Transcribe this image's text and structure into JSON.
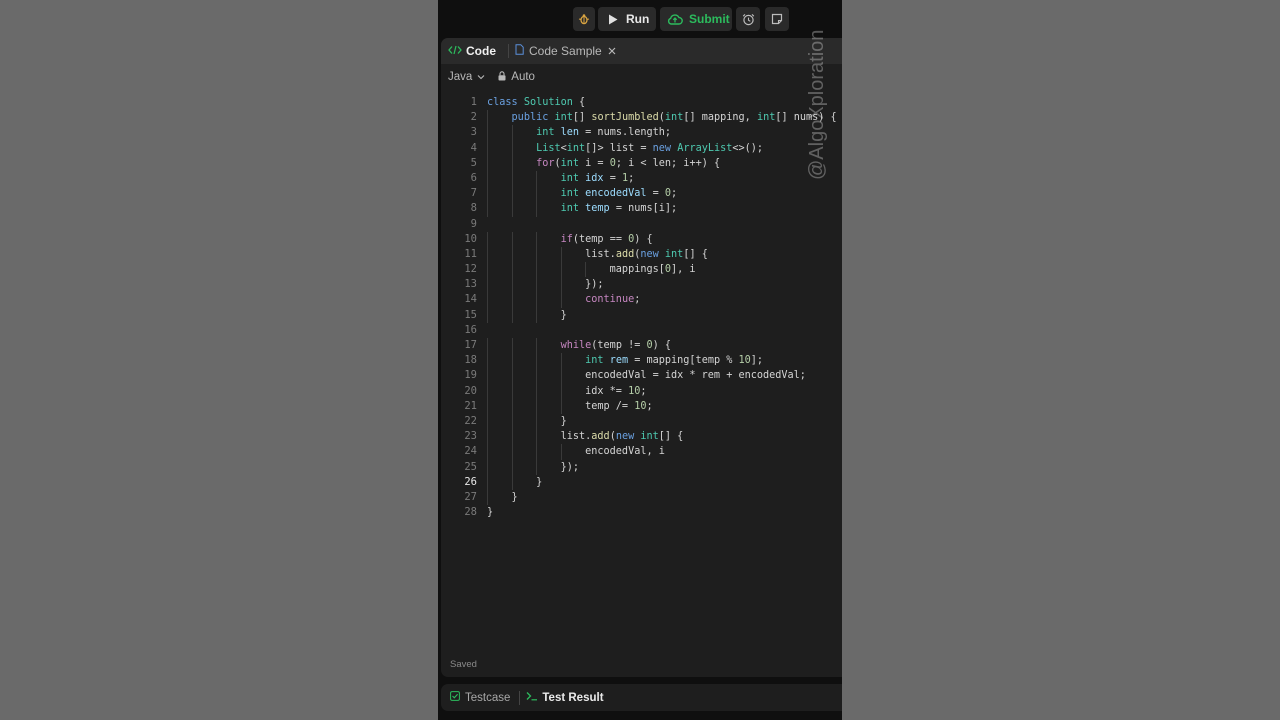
{
  "toolbar": {
    "run_label": "Run",
    "submit_label": "Submit",
    "submit_color": "#2cbb5d"
  },
  "tabs": [
    {
      "label": "Code",
      "active": true
    },
    {
      "label": "Code Sample",
      "active": false
    }
  ],
  "editor_toolbar": {
    "language": "Java",
    "mode": "Auto"
  },
  "editor": {
    "active_line": 26,
    "lines": [
      "class Solution {",
      "    public int[] sortJumbled(int[] mapping, int[] nums) {",
      "        int len = nums.length;",
      "        List<int[]> list = new ArrayList<>();",
      "        for(int i = 0; i < len; i++) {",
      "            int idx = 1;",
      "            int encodedVal = 0;",
      "            int temp = nums[i];",
      "",
      "            if(temp == 0) {",
      "                list.add(new int[] {",
      "                    mappings[0], i",
      "                });",
      "                continue;",
      "            }",
      "",
      "            while(temp != 0) {",
      "                int rem = mapping[temp % 10];",
      "                encodedVal = idx * rem + encodedVal;",
      "                idx *= 10;",
      "                temp /= 10;",
      "            }",
      "            list.add(new int[] {",
      "                encodedVal, i",
      "            });",
      "        }",
      "    }",
      "}"
    ]
  },
  "status": {
    "saved": "Saved"
  },
  "bottom_tabs": [
    {
      "label": "Testcase"
    },
    {
      "label": "Test Result"
    }
  ],
  "watermark": "@AlgoXploration",
  "colors": {
    "accent_green": "#2cbb5d",
    "keyword": "#6aa0e0",
    "type": "#4ec9b0",
    "function": "#dcdcaa",
    "variable": "#9cdcfe",
    "number": "#b5cea8"
  }
}
